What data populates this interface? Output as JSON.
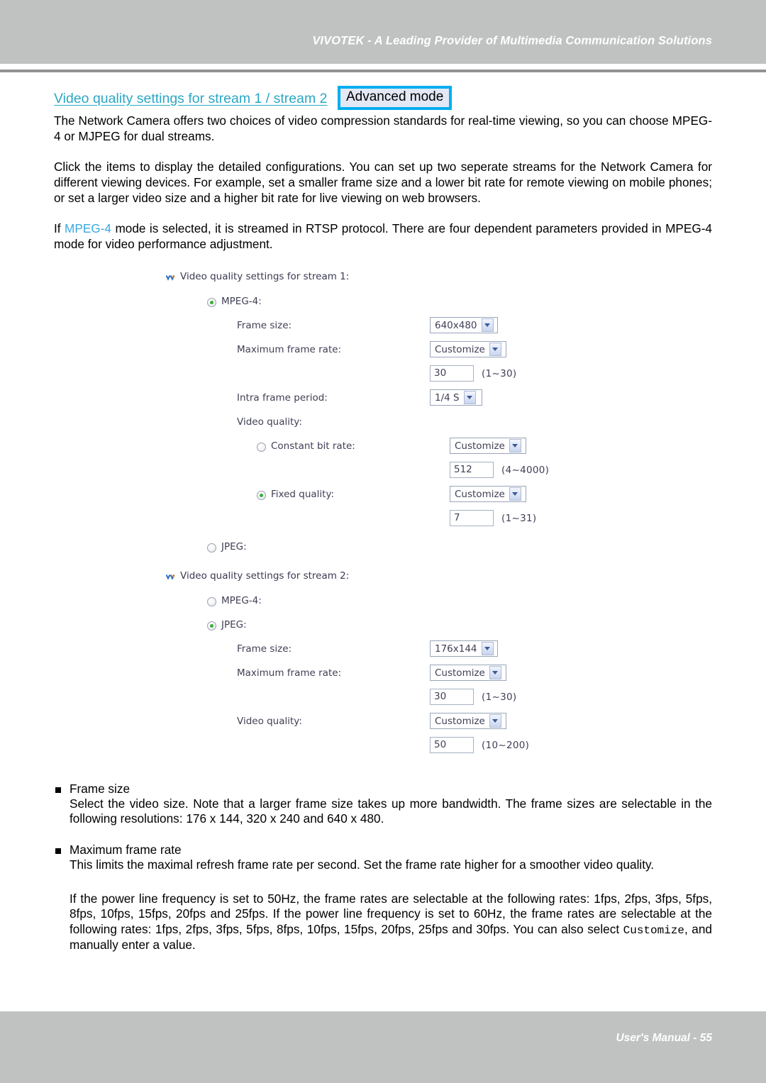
{
  "header": {
    "title": "VIVOTEK - A Leading Provider of Multimedia Communication Solutions"
  },
  "section": {
    "title": "Video quality settings for stream 1 / stream 2",
    "badge": "Advanced mode"
  },
  "paragraphs": {
    "p1": "The Network Camera offers two choices of video compression standards for real-time viewing, so you can choose MPEG-4 or MJPEG for dual streams.",
    "p2": "Click the items to display the detailed configurations. You can set up two seperate streams for the Network Camera for different viewing devices. For example, set a smaller frame size and a lower bit rate for remote viewing on mobile phones; or set a larger video size and a higher bit rate for live viewing on web browsers.",
    "p3_pre": "If ",
    "p3_accent": "MPEG-4",
    "p3_post": " mode is selected, it is streamed in RTSP protocol. There are four dependent parameters provided  in MPEG-4 mode for video performance adjustment."
  },
  "ui": {
    "stream1": {
      "group_label": "Video quality settings for stream 1:",
      "mpeg4_label": "MPEG-4:",
      "mpeg4_selected": true,
      "frame_size_label": "Frame size:",
      "frame_size_value": "640x480",
      "max_frame_rate_label": "Maximum frame rate:",
      "max_frame_rate_value": "Customize",
      "max_frame_rate_input": "30",
      "max_frame_rate_range": "(1~30)",
      "intra_label": "Intra frame period:",
      "intra_value": "1/4 S",
      "video_quality_label": "Video quality:",
      "cbr_label": "Constant bit rate:",
      "cbr_selected": false,
      "cbr_value": "Customize",
      "cbr_input": "512",
      "cbr_range": "(4~4000)",
      "fixed_label": "Fixed quality:",
      "fixed_selected": true,
      "fixed_value": "Customize",
      "fixed_input": "7",
      "fixed_range": "(1~31)",
      "jpeg_label": "JPEG:",
      "jpeg_selected": false
    },
    "stream2": {
      "group_label": "Video quality settings for stream 2:",
      "mpeg4_label": "MPEG-4:",
      "mpeg4_selected": false,
      "jpeg_label": "JPEG:",
      "jpeg_selected": true,
      "frame_size_label": "Frame size:",
      "frame_size_value": "176x144",
      "max_frame_rate_label": "Maximum frame rate:",
      "max_frame_rate_value": "Customize",
      "max_frame_rate_input": "30",
      "max_frame_rate_range": "(1~30)",
      "video_quality_label": "Video quality:",
      "video_quality_value": "Customize",
      "video_quality_input": "50",
      "video_quality_range": "(10~200)"
    }
  },
  "bullets": [
    {
      "title": "Frame size",
      "body": "Select the video size. Note that a larger frame size takes up more bandwidth. The frame sizes are selectable in the following resolutions: 176 x 144, 320 x 240 and 640 x 480."
    },
    {
      "title": "Maximum frame rate",
      "body": "This limits the maximal refresh frame rate per second. Set the frame rate higher for a smoother video quality."
    }
  ],
  "note": {
    "pre": "If the power line frequency is set to 50Hz, the frame rates are selectable at the following rates: 1fps, 2fps, 3fps, 5fps, 8fps, 10fps, 15fps, 20fps and 25fps. If the power line frequency is set to 60Hz, the frame rates are selectable at the following rates: 1fps, 2fps, 3fps, 5fps, 8fps, 10fps, 15fps, 20fps, 25fps and 30fps. You can also select ",
    "mono": "Customize",
    "post": ", and manually enter a value."
  },
  "footer": {
    "text": "User's Manual - 55"
  },
  "colors": {
    "accent": "#3ba9e0",
    "heading": "#2ba7c4",
    "badge_border": "#00aeef",
    "badge_fill": "#e4e8f5",
    "band": "#c0c2c2",
    "radio_dot": "#36b037"
  }
}
